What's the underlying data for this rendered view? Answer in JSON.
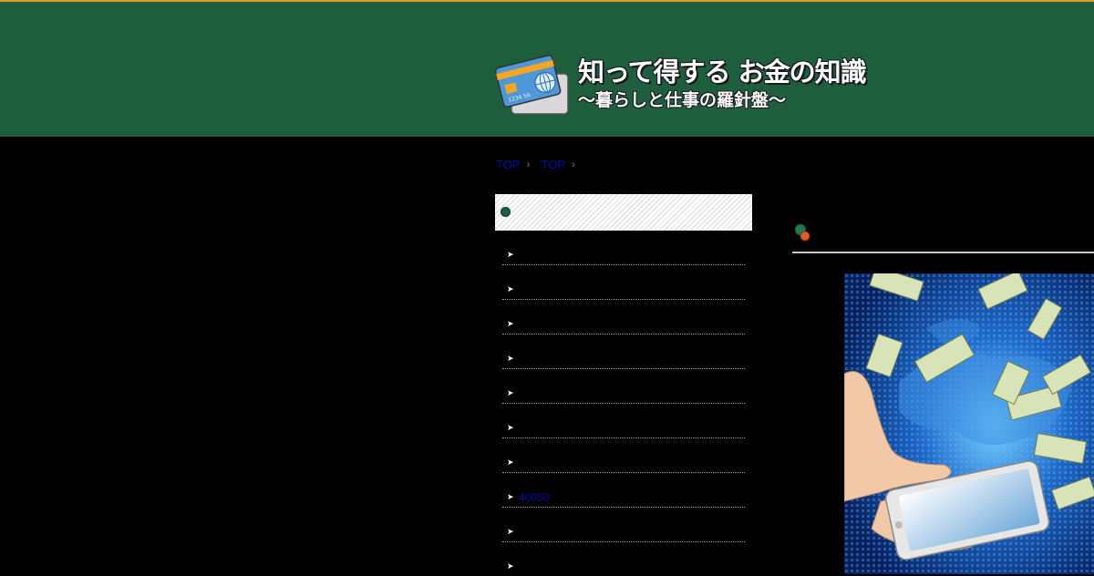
{
  "header": {
    "title": "知って得する お金の知識",
    "subtitle": "〜暮らしと仕事の羅針盤〜",
    "logo_icon": "credit-card-icon",
    "logo_card_number": "1234 56",
    "colors": {
      "background": "#1e5e3f",
      "accent_line": "#e39b1b"
    }
  },
  "breadcrumb": {
    "items": [
      {
        "label": "TOP"
      },
      {
        "label": "TOP"
      }
    ],
    "separator": "›"
  },
  "sidebar": {
    "heading_icon": "green-dot-icon",
    "items": [
      {
        "label": ""
      },
      {
        "label": ""
      },
      {
        "label": ""
      },
      {
        "label": ""
      },
      {
        "label": ""
      },
      {
        "label": ""
      },
      {
        "label": ""
      },
      {
        "label": "40050"
      },
      {
        "label": ""
      },
      {
        "label": ""
      }
    ],
    "bullet": "➤"
  },
  "main": {
    "title_icon": "green-orange-dots-icon",
    "image": "smartphone-money-world-map-image"
  }
}
